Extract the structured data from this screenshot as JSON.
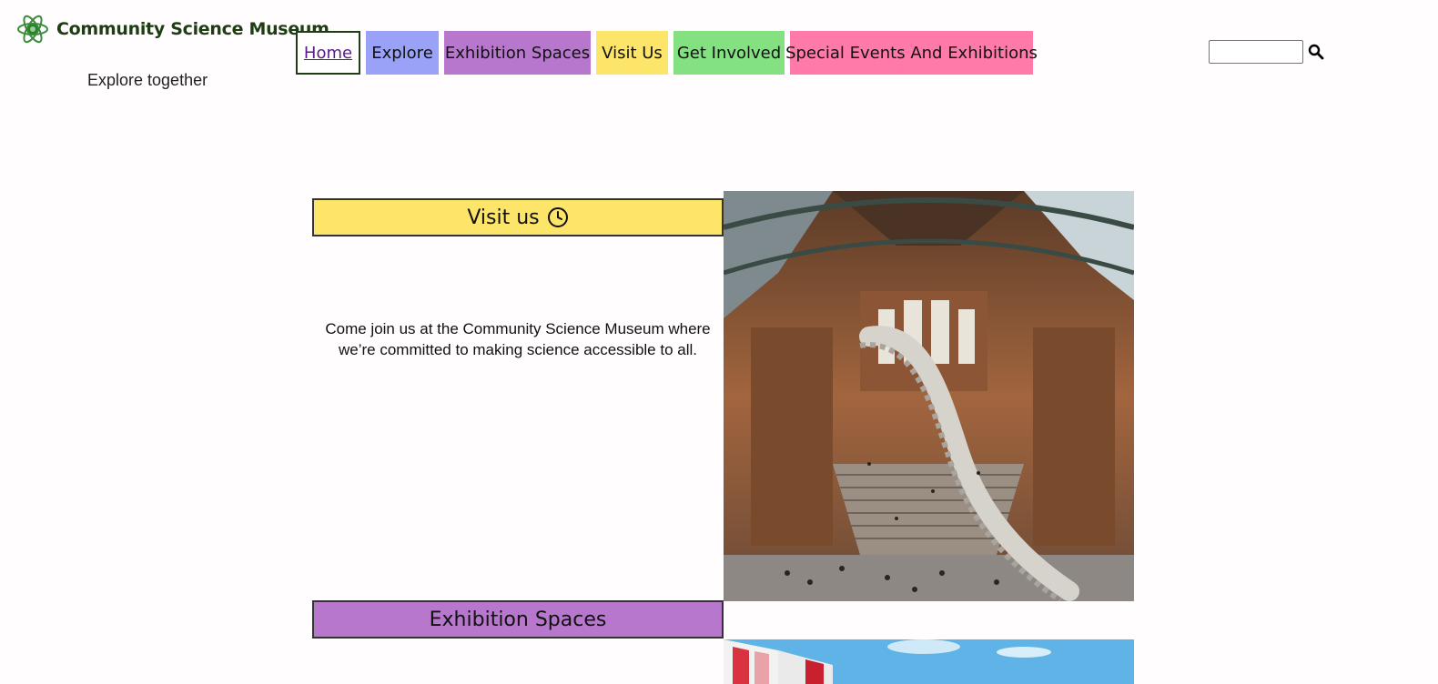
{
  "header": {
    "site_name": "Community Science Museum",
    "tagline": "Explore together"
  },
  "nav": {
    "home": "Home",
    "explore": "Explore",
    "exhibition_spaces": "Exhibition Spaces",
    "visit_us": "Visit Us",
    "get_involved": "Get Involved",
    "special_events": "Special Events And Exhibitions"
  },
  "search": {
    "value": ""
  },
  "visit": {
    "heading": "Visit us",
    "text": "Come join us at the Community Science Museum where we’re committed to making science accessible to all."
  },
  "exhibition_spaces": {
    "heading": "Exhibition Spaces"
  },
  "colors": {
    "explore": "#9aa2f7",
    "spaces": "#b677cc",
    "visit": "#fde56a",
    "involved": "#84e182",
    "special": "#ff7aa8",
    "brand": "#1f3d14"
  },
  "icons": [
    "atom-logo-icon",
    "search-icon",
    "clock-icon"
  ]
}
